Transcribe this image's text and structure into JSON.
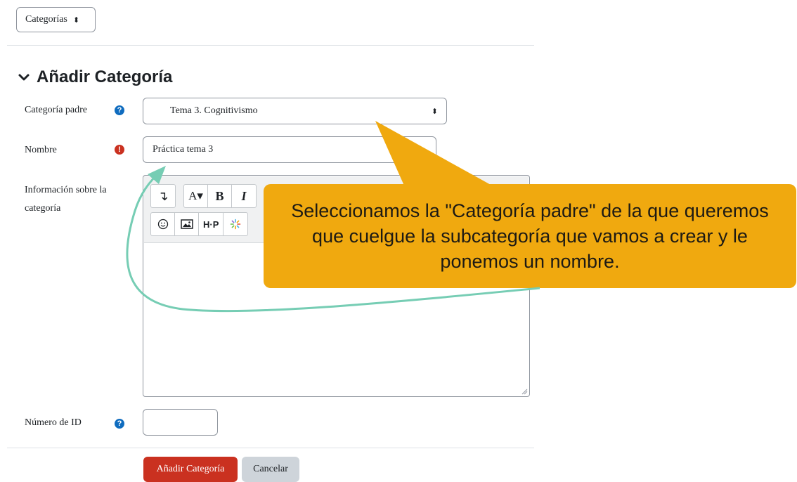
{
  "top": {
    "category_select": "Categorías",
    "select_arrow": "⬍"
  },
  "section": {
    "title": "Añadir Categoría"
  },
  "form": {
    "parent_label": "Categoría padre",
    "parent_value": "Tema 3. Cognitivismo",
    "name_label": "Nombre",
    "name_value": "Práctica tema 3",
    "info_label": "Información sobre la categoría",
    "id_label": "Número de ID",
    "id_value": ""
  },
  "toolbar": {
    "row1": [
      "A▾",
      "B"
    ],
    "row2": [
      "H·P"
    ]
  },
  "buttons": {
    "submit": "Añadir Categoría",
    "cancel": "Cancelar"
  },
  "callout": {
    "text": "Seleccionamos la \"Categoría padre\" de la que queremos que cuelgue la subcategoría que vamos a crear y le ponemos un nombre."
  },
  "colors": {
    "primary": "#ca3120",
    "callout": "#f0a90f",
    "arrow": "#76cdb4",
    "help": "#0f6cbf"
  }
}
